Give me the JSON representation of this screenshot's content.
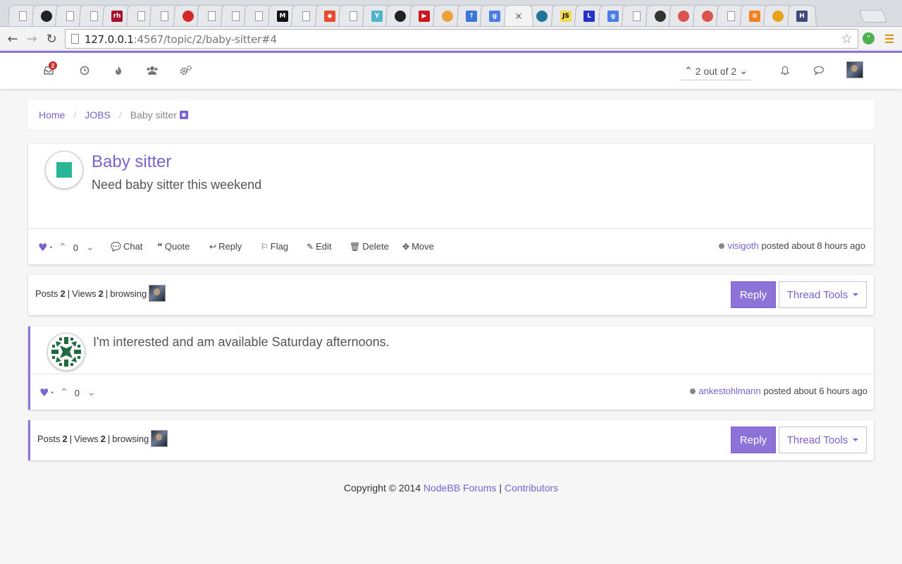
{
  "browser": {
    "url_host": "127.0.0.1",
    "url_path": ":4567/topic/2/baby-sitter#4",
    "active_tab_close": "×",
    "tabs": [
      {
        "icon": "page-icon",
        "kind": "page"
      },
      {
        "icon": "github-icon",
        "kind": "circle",
        "color": "#222222"
      },
      {
        "icon": "page-icon",
        "kind": "page"
      },
      {
        "icon": "page-icon",
        "kind": "page"
      },
      {
        "icon": "redhat-icon",
        "kind": "box",
        "color": "#a8102c",
        "text": "rh"
      },
      {
        "icon": "page-icon",
        "kind": "page"
      },
      {
        "icon": "page-icon",
        "kind": "page"
      },
      {
        "icon": "red-puzzle-icon",
        "kind": "circle",
        "color": "#d62828"
      },
      {
        "icon": "page-icon",
        "kind": "page"
      },
      {
        "icon": "page-icon",
        "kind": "page"
      },
      {
        "icon": "page-icon",
        "kind": "page"
      },
      {
        "icon": "medium-icon",
        "kind": "box",
        "color": "#111111",
        "text": "M"
      },
      {
        "icon": "page-icon",
        "kind": "page"
      },
      {
        "icon": "git-icon",
        "kind": "box",
        "color": "#e84d31",
        "text": "◆"
      },
      {
        "icon": "page-icon",
        "kind": "page"
      },
      {
        "icon": "funnel-icon",
        "kind": "box",
        "color": "#4fb3c9",
        "text": "Y"
      },
      {
        "icon": "github-icon",
        "kind": "circle",
        "color": "#222222"
      },
      {
        "icon": "youtube-icon",
        "kind": "box",
        "color": "#cc181e",
        "text": "▶"
      },
      {
        "icon": "chrome-icon",
        "kind": "circle",
        "color": "#e9a33a"
      },
      {
        "icon": "upload-icon",
        "kind": "box",
        "color": "#3b77d6",
        "text": "↑"
      },
      {
        "icon": "google-icon",
        "kind": "box",
        "color": "#4a7de8",
        "text": "g"
      },
      {
        "icon": "close-icon",
        "kind": "active"
      },
      {
        "icon": "wordpress-icon",
        "kind": "circle",
        "color": "#21759b"
      },
      {
        "icon": "js-icon",
        "kind": "box",
        "color": "#f0db4f",
        "text": "JS"
      },
      {
        "icon": "l-icon",
        "kind": "box",
        "color": "#2633c9",
        "text": "L"
      },
      {
        "icon": "google-icon",
        "kind": "box",
        "color": "#4a7de8",
        "text": "g"
      },
      {
        "icon": "page-icon",
        "kind": "page"
      },
      {
        "icon": "hex-icon",
        "kind": "circle",
        "color": "#333333"
      },
      {
        "icon": "record-icon",
        "kind": "circle",
        "color": "#d9534f"
      },
      {
        "icon": "record-icon",
        "kind": "circle",
        "color": "#d9534f"
      },
      {
        "icon": "page-icon",
        "kind": "page"
      },
      {
        "icon": "stackoverflow-icon",
        "kind": "box",
        "color": "#f48024",
        "text": "≡"
      },
      {
        "icon": "pinwheel-icon",
        "kind": "circle",
        "color": "#e5a21a"
      },
      {
        "icon": "hacker-icon",
        "kind": "box",
        "color": "#3e4a7a",
        "text": "H"
      }
    ]
  },
  "header": {
    "notification_count": "2",
    "pagination_text": "2 out of 2",
    "icons": [
      "inbox-icon",
      "clock-icon",
      "fire-icon",
      "users-icon",
      "cogs-icon",
      "bell-icon",
      "comment-icon"
    ]
  },
  "breadcrumb": {
    "home": "Home",
    "category": "JOBS",
    "current": "Baby sitter"
  },
  "topic": {
    "title": "Baby sitter",
    "body": "Need baby sitter this weekend",
    "votes": "0",
    "actions": {
      "chat": "Chat",
      "quote": "Quote",
      "reply": "Reply",
      "flag": "Flag",
      "edit": "Edit",
      "delete": "Delete",
      "move": "Move"
    },
    "author": "visigoth",
    "posted_text": "posted about 8 hours ago"
  },
  "stats": {
    "posts_label": "Posts",
    "posts_count": "2",
    "views_label": "Views",
    "views_count": "2",
    "browsing_label": "browsing",
    "sep": "|"
  },
  "buttons": {
    "reply": "Reply",
    "thread_tools": "Thread Tools"
  },
  "reply_post": {
    "body": "I'm interested and am available Saturday afternoons.",
    "votes": "0",
    "author": "ankestohlmann",
    "posted_text": "posted about 6 hours ago"
  },
  "footer": {
    "copyright": "Copyright © 2014",
    "link1": "NodeBB Forums",
    "sep": "|",
    "link2": "Contributors"
  },
  "colors": {
    "accent": "#8c73d8",
    "link": "#7b62d0",
    "topic_avatar": "#2bb597",
    "reply_avatar": "#1e6b3e"
  }
}
